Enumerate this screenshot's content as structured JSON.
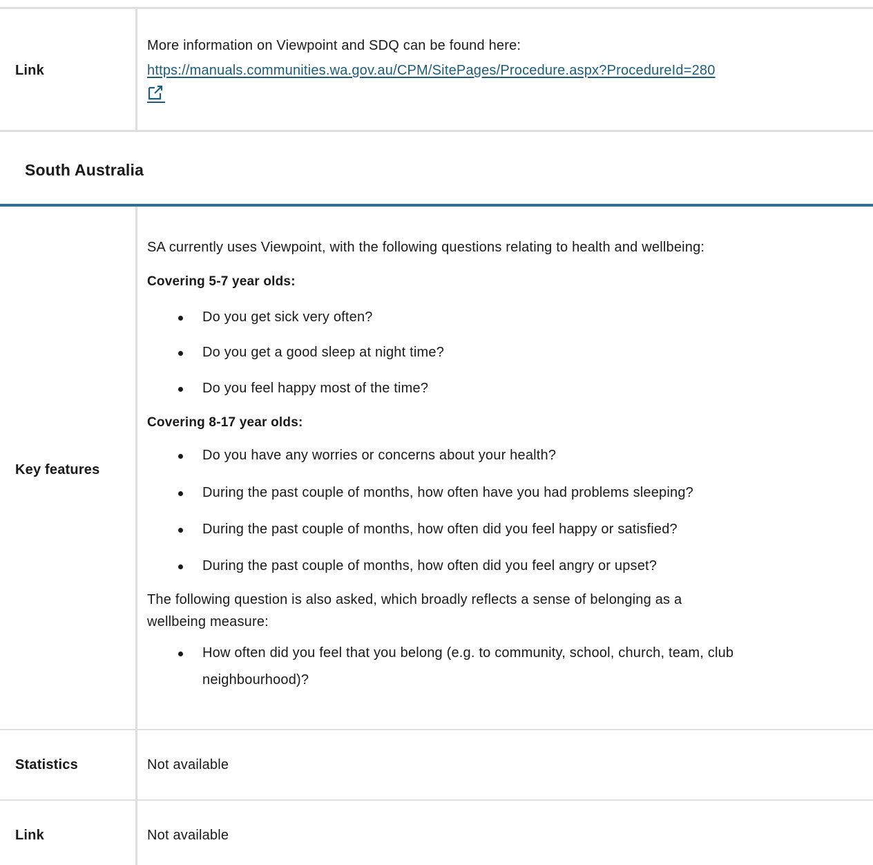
{
  "wa_section": {
    "link_label": "Link",
    "link_intro": "More information on Viewpoint and SDQ can be found here:",
    "link_url": "https://manuals.communities.wa.gov.au/CPM/SitePages/Procedure.aspx?ProcedureId=280",
    "link_icon": "external-link-icon"
  },
  "sa_section": {
    "title": "South Australia",
    "key_features_label": "Key features",
    "intro": "SA currently uses Viewpoint, with the following questions relating to health and wellbeing:",
    "group1_heading": "Covering 5-7 year olds:",
    "group1_items": [
      "Do you get sick very often?",
      "Do you get a good sleep at night time?",
      "Do you feel happy most of the time?"
    ],
    "group2_heading": "Covering 8-17 year olds:",
    "group2_items": [
      "Do you have any worries or concerns about your health?",
      "During the past couple of months, how often have you had problems sleeping?",
      "During the past couple of months, how often did you feel happy or satisfied?",
      "During the past couple of months, how often did you feel angry or upset?"
    ],
    "belonging_text_line1": "The following question is also asked, which broadly reflects a sense of belonging as a",
    "belonging_text_line2": "wellbeing measure:",
    "belonging_item_line1": "How often did you feel that you belong (e.g. to community, school, church, team, club",
    "belonging_item_line2": "neighbourhood)?",
    "statistics_label": "Statistics",
    "statistics_value": "Not available",
    "link_label": "Link",
    "link_value": "Not available"
  },
  "colors": {
    "link": "#1c5d7c",
    "section_rule": "#2f6f96",
    "table_rule": "#dedede"
  }
}
